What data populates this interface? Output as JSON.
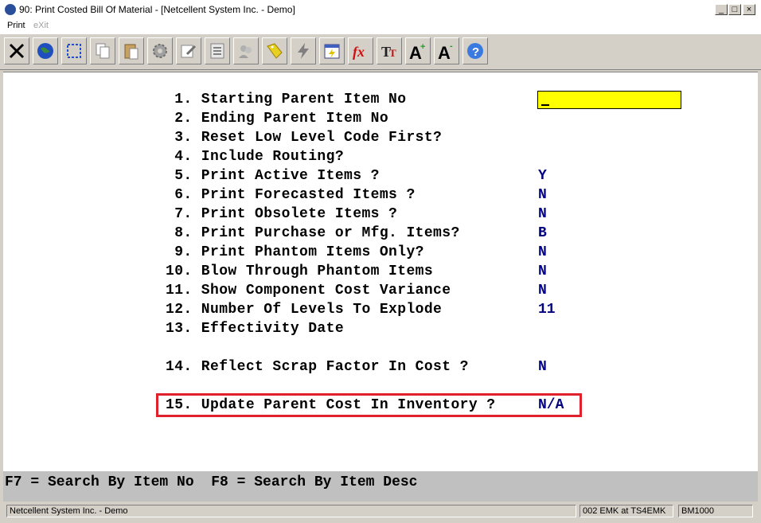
{
  "window": {
    "title": "90: Print Costed Bill Of Material - [Netcellent System Inc. - Demo]",
    "minimize": "_",
    "maximize": "□",
    "close": "×"
  },
  "menu": {
    "print": "Print",
    "exit": "eXit"
  },
  "toolbar": {
    "icons": [
      "close-x-icon",
      "globe-icon",
      "select-icon",
      "copy-icon",
      "paste-icon",
      "settings-icon",
      "edit-icon",
      "list-icon",
      "users-icon",
      "key-tag-icon",
      "lightning-icon",
      "calendar-icon",
      "function-fx-icon",
      "font-tt-icon",
      "font-increase-icon",
      "font-decrease-icon",
      "help-icon"
    ]
  },
  "form": {
    "fields": [
      {
        "label": " 1. Starting Parent Item No",
        "value": ""
      },
      {
        "label": " 2. Ending Parent Item No",
        "value": ""
      },
      {
        "label": " 3. Reset Low Level Code First?",
        "value": ""
      },
      {
        "label": " 4. Include Routing?",
        "value": ""
      },
      {
        "label": " 5. Print Active Items ?",
        "value": "Y"
      },
      {
        "label": " 6. Print Forecasted Items ?",
        "value": "N"
      },
      {
        "label": " 7. Print Obsolete Items ?",
        "value": "N"
      },
      {
        "label": " 8. Print Purchase or Mfg. Items?",
        "value": "B"
      },
      {
        "label": " 9. Print Phantom Items Only?",
        "value": "N"
      },
      {
        "label": "10. Blow Through Phantom Items",
        "value": "N"
      },
      {
        "label": "11. Show Component Cost Variance",
        "value": "N"
      },
      {
        "label": "12. Number Of Levels To Explode",
        "value": "11"
      },
      {
        "label": "13. Effectivity Date",
        "value": ""
      },
      {
        "label": "14. Reflect Scrap Factor In Cost ?",
        "value": "N"
      },
      {
        "label": "15. Update Parent Cost In Inventory ?",
        "value": "N/A"
      }
    ]
  },
  "fkeys": {
    "text": "F7 = Search By Item No  F8 = Search By Item Desc"
  },
  "status": {
    "company": "Netcellent System Inc. - Demo",
    "user": "002 EMK at TS4EMK",
    "code": "BM1000"
  },
  "colors": {
    "highlight": "#e0202a",
    "input": "#ffff00",
    "value_text": "#000080"
  }
}
